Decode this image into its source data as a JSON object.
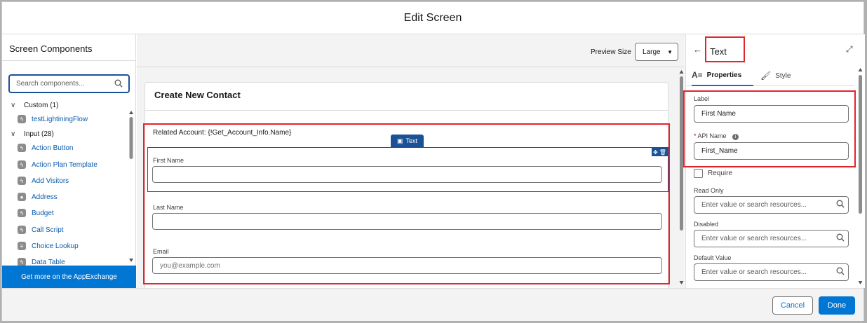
{
  "modal": {
    "title": "Edit Screen"
  },
  "footer": {
    "cancel": "Cancel",
    "done": "Done"
  },
  "left_panel": {
    "title": "Screen Components",
    "search_placeholder": "Search components...",
    "groups": [
      {
        "label": "Custom (1)",
        "items": [
          "testLightiningFlow"
        ]
      },
      {
        "label": "Input (28)",
        "items": [
          "Action Button",
          "Action Plan Template",
          "Add Visitors",
          "Address",
          "Budget",
          "Call Script",
          "Choice Lookup",
          "Data Table"
        ]
      }
    ],
    "appexchange": "Get more on the AppExchange"
  },
  "preview": {
    "label": "Preview Size",
    "value": "Large"
  },
  "canvas": {
    "card_title": "Create New Contact",
    "related": "Related Account: {!Get_Account_Info.Name}",
    "selected_tag": "Text",
    "fields": [
      {
        "label": "First Name",
        "placeholder": ""
      },
      {
        "label": "Last Name",
        "placeholder": ""
      },
      {
        "label": "Email",
        "placeholder": "you@example.com"
      }
    ]
  },
  "properties": {
    "title": "Text",
    "tabs": {
      "properties": "Properties",
      "style": "Style"
    },
    "label_label": "Label",
    "label_value": "First Name",
    "api_label": "API Name",
    "api_value": "First_Name",
    "require": "Require",
    "read_only": "Read Only",
    "disabled": "Disabled",
    "default_value": "Default Value",
    "resource_placeholder": "Enter value or search resources..."
  },
  "colors": {
    "brand_blue": "#0176d3",
    "highlight_red": "#e3242b",
    "selection_navy": "#1b5297"
  }
}
